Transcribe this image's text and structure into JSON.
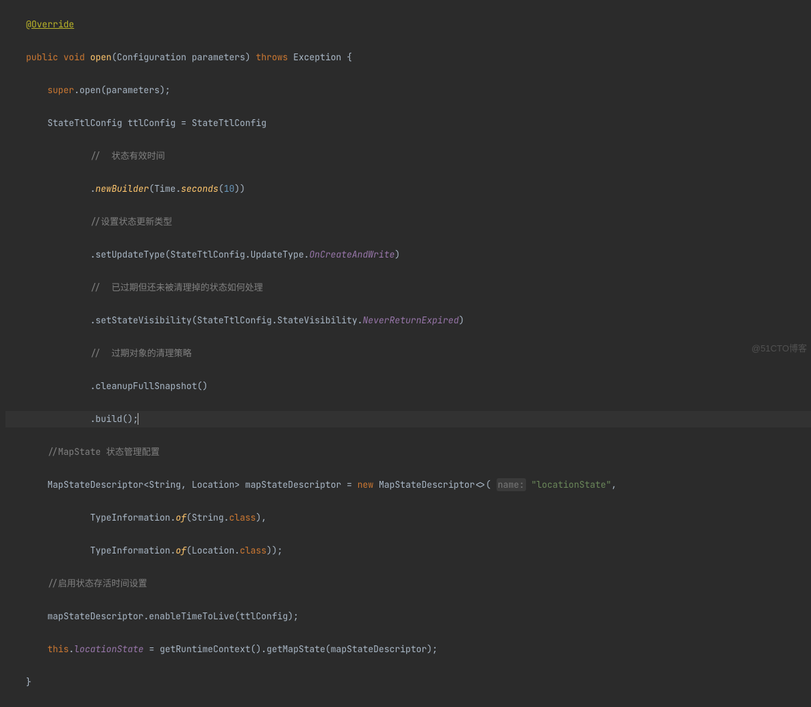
{
  "code": {
    "annotation_at": "@",
    "annotation_name": "Override",
    "kw_public": "public",
    "kw_void": "void",
    "mth_open": "open",
    "param_type": "Configuration",
    "param_name": "parameters",
    "kw_throws": "throws",
    "exception": "Exception",
    "kw_super": "super",
    "mth_open2": "open",
    "var_params": "parameters",
    "type_StateTtlConfig": "StateTtlConfig",
    "var_ttlConfig": "ttlConfig",
    "cmt_valid": "//  状态有效时间",
    "mth_newBuilder": "newBuilder",
    "type_Time": "Time",
    "mth_seconds": "seconds",
    "num_10": "10",
    "cmt_update": "//设置状态更新类型",
    "mth_setUpdateType": "setUpdateType",
    "enum_UpdateType": "UpdateType",
    "enum_OnCreateAndWrite": "OnCreateAndWrite",
    "cmt_expired": "//  已过期但还未被清理掉的状态如何处理",
    "mth_setStateVisibility": "setStateVisibility",
    "enum_StateVisibility": "StateVisibility",
    "enum_NeverReturnExpired": "NeverReturnExpired",
    "cmt_cleanup": "//  过期对象的清理策略",
    "mth_cleanupFullSnapshot": "cleanupFullSnapshot",
    "mth_build": "build",
    "cmt_mapstate": "//MapState 状态管理配置",
    "type_MapStateDescriptor": "MapStateDescriptor",
    "type_String": "String",
    "type_Location": "Location",
    "var_mapStateDescriptor": "mapStateDescriptor",
    "kw_new": "new",
    "hint_name": "name:",
    "str_locationState": "\"locationState\"",
    "type_TypeInformation": "TypeInformation",
    "mth_of": "of",
    "kw_class": "class",
    "cmt_ttl_enable": "//启用状态存活时间设置",
    "mth_enableTimeToLive": "enableTimeToLive",
    "kw_this": "this",
    "fld_locationState": "locationState",
    "mth_getRuntimeContext": "getRuntimeContext",
    "mth_getMapState": "getMapState",
    "lbrace": "{",
    "rbrace": "}",
    "lparen": "(",
    "rparen": ")",
    "lt": "<",
    "gt": ">",
    "dot": ".",
    "comma": ",",
    "semi": ";",
    "eq": "=",
    "space": " "
  },
  "watermark": "@51CTO博客"
}
